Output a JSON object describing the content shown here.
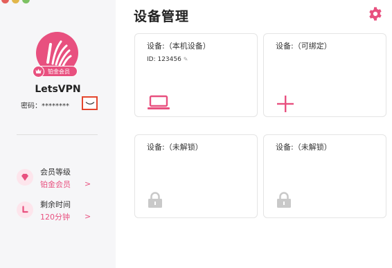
{
  "sidebar": {
    "membership_badge": "铂金会员",
    "username": "LetsVPN",
    "password": "密码：********",
    "info": [
      {
        "label": "会员等级",
        "value": "铂金会员",
        "chevron": ">"
      },
      {
        "label": "剩余时间",
        "value": "120分钟",
        "chevron": ">"
      }
    ]
  },
  "main": {
    "title": "设备管理",
    "devices": [
      {
        "title": "设备:（本机设备）",
        "id": "ID: 123456",
        "icon": "laptop-icon"
      },
      {
        "title": "设备:（可绑定）",
        "icon": "plus-icon"
      },
      {
        "title": "设备:（未解锁）",
        "icon": "lock-icon"
      },
      {
        "title": "设备:（未解锁）",
        "icon": "lock-icon"
      }
    ]
  },
  "colors": {
    "accent": "#e8507f",
    "sidebar_bg": "#f6f6f8",
    "highlight_box": "#e4462d",
    "lock_gray": "#c9c9c9"
  }
}
